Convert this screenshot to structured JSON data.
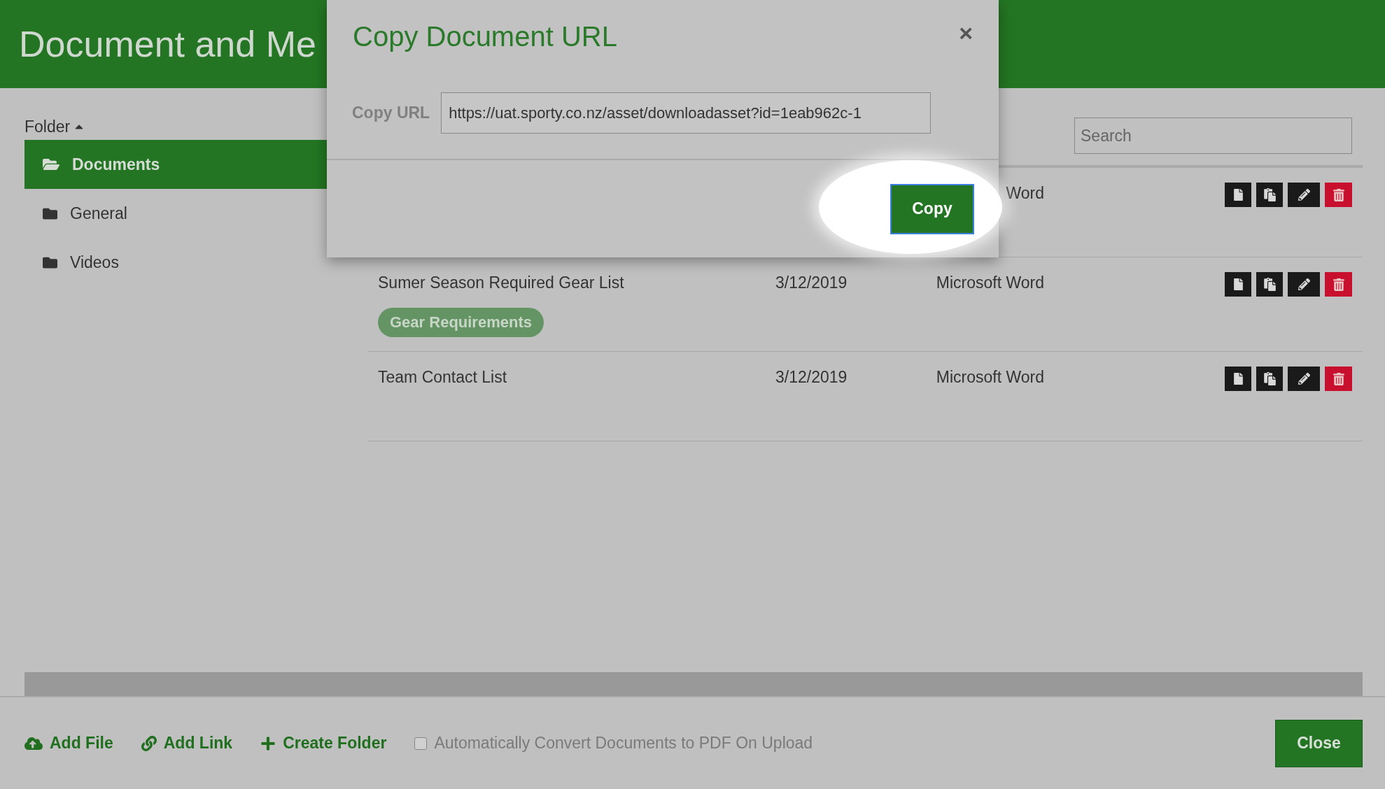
{
  "header": {
    "title": "Document and Me"
  },
  "sidebar": {
    "heading": "Folder",
    "folders": [
      {
        "label": "Documents",
        "selected": true
      },
      {
        "label": "General",
        "selected": false
      },
      {
        "label": "Videos",
        "selected": false
      }
    ]
  },
  "search": {
    "placeholder": "Search"
  },
  "table": {
    "rows": [
      {
        "type": "Word"
      },
      {
        "name": "Sumer Season Required Gear List",
        "date": "3/12/2019",
        "type": "Microsoft Word",
        "tags": [
          "Gear Requirements"
        ]
      },
      {
        "name": "Team Contact List",
        "date": "3/12/2019",
        "type": "Microsoft Word"
      }
    ]
  },
  "footer": {
    "actions": [
      {
        "kind": "upload",
        "label": "Add File"
      },
      {
        "kind": "link",
        "label": "Add Link"
      },
      {
        "kind": "add",
        "label": "Create Folder"
      }
    ],
    "auto_convert": {
      "label": "Automatically Convert Documents to PDF On Upload",
      "checked": false
    },
    "close": "Close"
  },
  "dialog": {
    "title": "Copy Document URL",
    "close": "×",
    "url_label": "Copy URL",
    "url_value": "https://uat.sporty.co.nz/asset/downloadasset?id=1eab962c-1",
    "button": "Copy"
  }
}
